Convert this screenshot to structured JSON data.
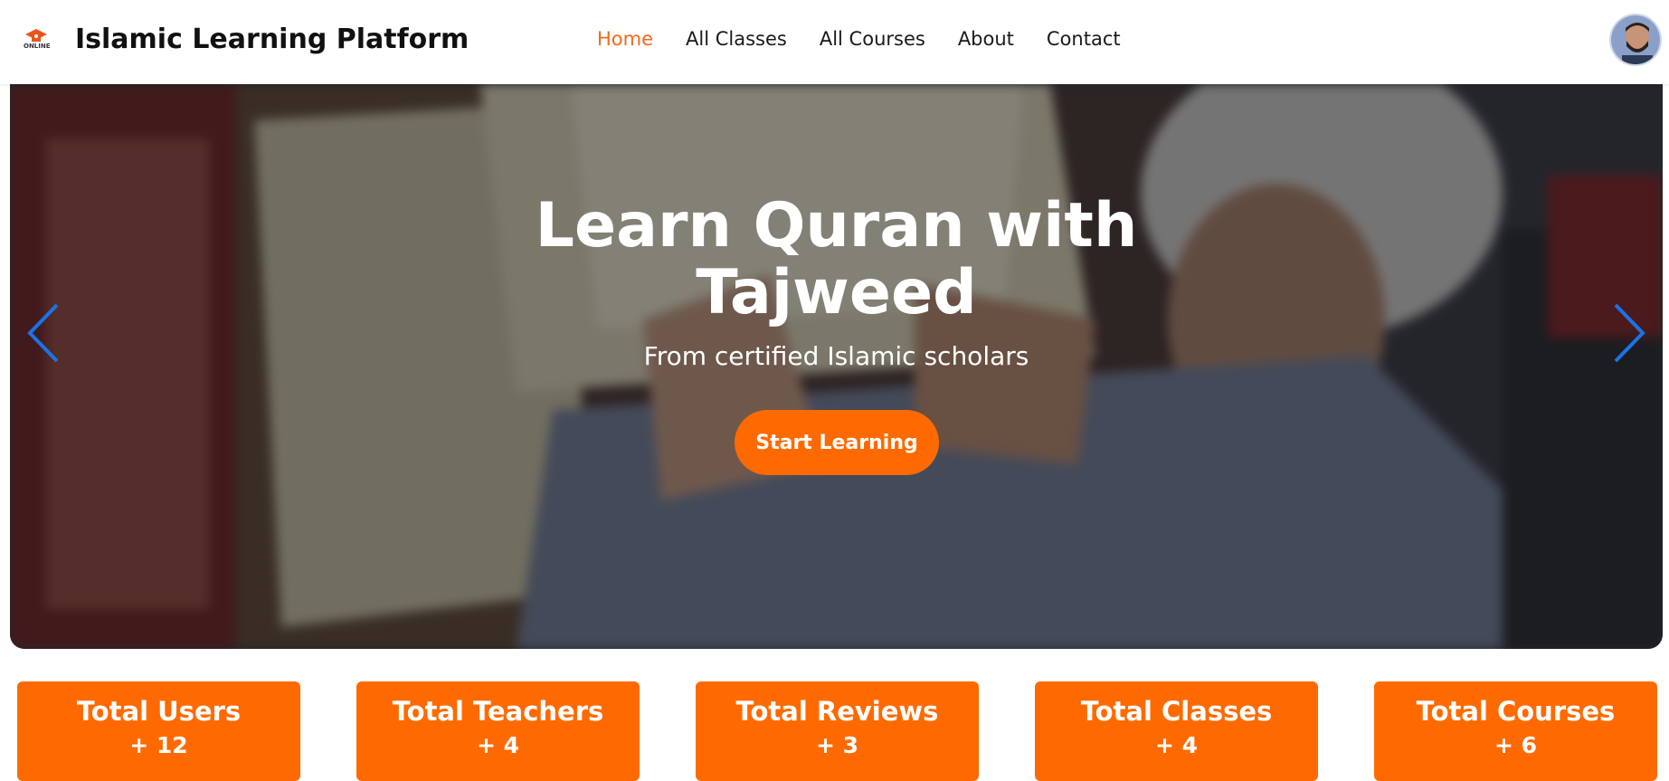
{
  "header": {
    "brand": "Islamic Learning Platform",
    "logo_text": "ONLINE",
    "nav": [
      {
        "label": "Home",
        "active": true
      },
      {
        "label": "All Classes",
        "active": false
      },
      {
        "label": "All Courses",
        "active": false
      },
      {
        "label": "About",
        "active": false
      },
      {
        "label": "Contact",
        "active": false
      }
    ],
    "avatar_icon": "user-avatar"
  },
  "hero": {
    "title_line1": "Learn Quran with",
    "title_line2": "Tajweed",
    "subtitle": "From certified Islamic scholars",
    "cta_label": "Start Learning",
    "prev_icon": "chevron-left-icon",
    "next_icon": "chevron-right-icon"
  },
  "stats": [
    {
      "label": "Total Users",
      "value": "+ 12"
    },
    {
      "label": "Total Teachers",
      "value": "+ 4"
    },
    {
      "label": "Total Reviews",
      "value": "+ 3"
    },
    {
      "label": "Total Classes",
      "value": "+ 4"
    },
    {
      "label": "Total Courses",
      "value": "+ 6"
    }
  ],
  "colors": {
    "accent": "#ff6a00",
    "nav_active": "#f2691b",
    "arrow": "#1a73e8"
  }
}
